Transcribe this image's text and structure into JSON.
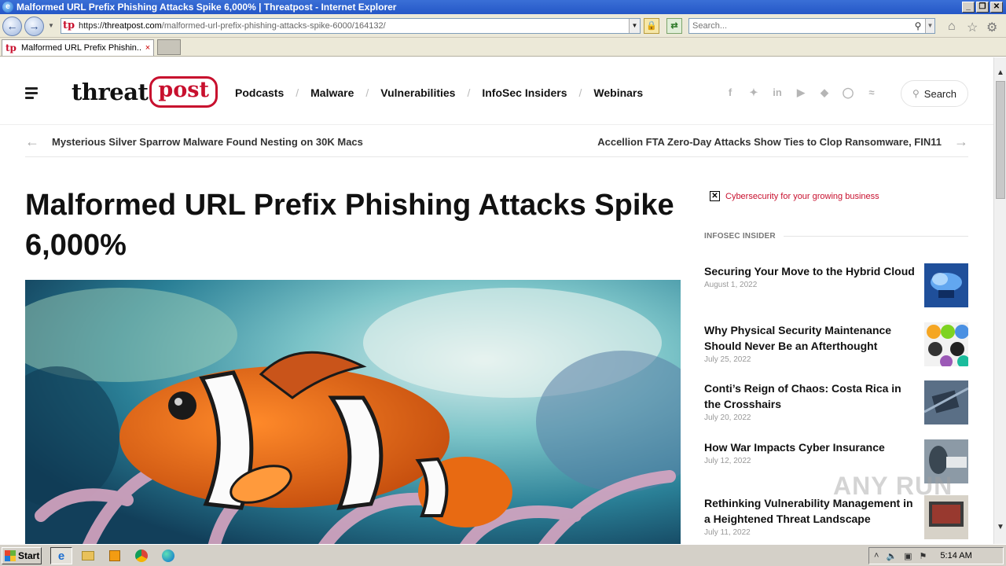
{
  "window": {
    "title": "Malformed URL Prefix Phishing Attacks Spike 6,000% | Threatpost - Internet Explorer",
    "controls": [
      "_",
      "❐",
      "✕"
    ]
  },
  "address_bar": {
    "scheme": "https://",
    "host": "threatpost.com",
    "path": "/malformed-url-prefix-phishing-attacks-spike-6000/164132/"
  },
  "browser_search": {
    "placeholder": "Search..."
  },
  "tab": {
    "label": "Malformed URL Prefix Phishin...",
    "close": "×"
  },
  "site": {
    "logo_threat": "threat",
    "logo_post": "post",
    "nav": [
      "Podcasts",
      "Malware",
      "Vulnerabilities",
      "InfoSec Insiders",
      "Webinars"
    ],
    "nav_separator": "/",
    "social": [
      "f",
      "t",
      "in",
      "yt",
      "fb",
      "ig",
      "rss"
    ],
    "search_label": "Search"
  },
  "article_nav": {
    "prev": "Mysterious Silver Sparrow Malware Found Nesting on 30K Macs",
    "next": "Accellion FTA Zero-Day Attacks Show Ties to Clop Ransomware, FIN11"
  },
  "article": {
    "title": "Malformed URL Prefix Phishing Attacks Spike 6,000%"
  },
  "sidebar": {
    "ad_text": "Cybersecurity for your growing business",
    "section_title": "INFOSEC INSIDER",
    "items": [
      {
        "title": "Securing Your Move to the Hybrid Cloud",
        "date": "August 1, 2022"
      },
      {
        "title": "Why Physical Security Maintenance Should Never Be an Afterthought",
        "date": "July 25, 2022"
      },
      {
        "title": "Conti’s Reign of Chaos: Costa Rica in the Crosshairs",
        "date": "July 20, 2022"
      },
      {
        "title": "How War Impacts Cyber Insurance",
        "date": "July 12, 2022"
      },
      {
        "title": "Rethinking Vulnerability Management in a Heightened Threat Landscape",
        "date": "July 11, 2022"
      }
    ]
  },
  "taskbar": {
    "start_label": "Start",
    "clock": "5:14 AM"
  },
  "watermark": "ANY RUN",
  "colors": {
    "brand_red": "#c8102e",
    "titlebar_blue": "#2557c7",
    "text_dark": "#111111"
  }
}
